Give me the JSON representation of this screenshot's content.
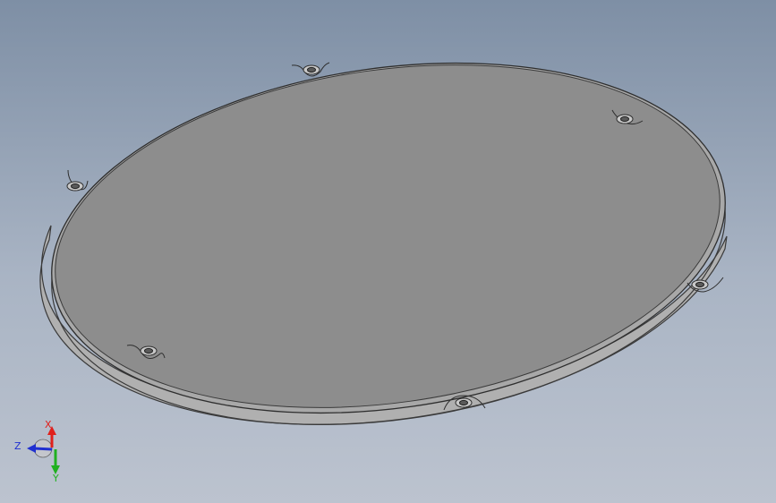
{
  "viewport": {
    "background_top": "#7e8fa5",
    "background_bottom": "#bcc3cf"
  },
  "model": {
    "face_color": "#8d8d8d",
    "edge_color": "#3a3a3a",
    "side_color": "#a3a3a3",
    "hole_count": 6,
    "hole_icon": "countersunk-hole-icon"
  },
  "triad": {
    "x_label": "X",
    "y_label": "Y",
    "z_label": "Z",
    "x_color": "#e0201c",
    "y_color": "#20b020",
    "z_color": "#2030d0"
  }
}
